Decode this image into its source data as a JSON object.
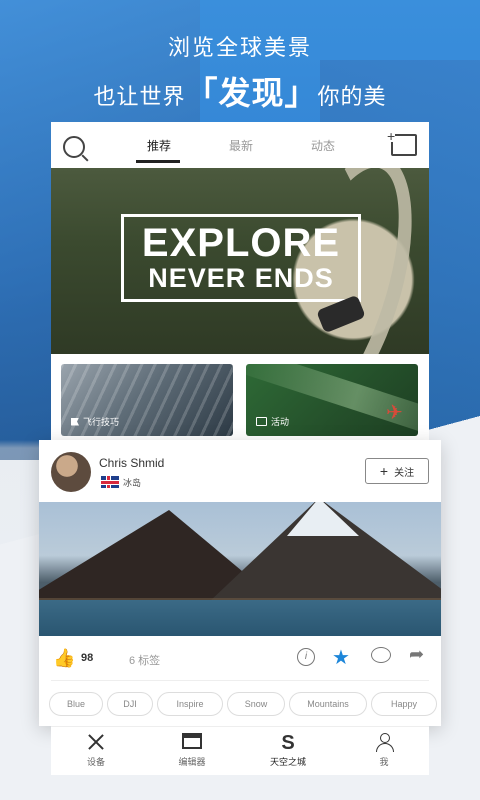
{
  "hero": {
    "line1": "浏览全球美景",
    "line2_prefix": "也让世界",
    "line2_open": "「",
    "line2_highlight": "发现",
    "line2_close": "」",
    "line2_suffix": "你的美"
  },
  "topbar": {
    "tabs": [
      {
        "label": "推荐",
        "active": true
      },
      {
        "label": "最新",
        "active": false
      },
      {
        "label": "动态",
        "active": false
      }
    ],
    "search_icon": "search-icon",
    "add_photo_icon": "add-photo-icon"
  },
  "banner": {
    "line1": "EXPLORE",
    "line2": "NEVER ENDS",
    "page_index": 1
  },
  "tiles": [
    {
      "label": "飞行技巧",
      "icon": "flag-icon"
    },
    {
      "label": "活动",
      "icon": "tag-icon"
    }
  ],
  "post": {
    "username": "Chris Shmid",
    "location": "冰岛",
    "follow_plus": "+",
    "follow_label": "关注",
    "like_count": "98",
    "tags_count": "6 标签",
    "tags": [
      "Blue",
      "DJI",
      "Inspire",
      "Snow",
      "Mountains",
      "Happy"
    ]
  },
  "bottom_nav": [
    {
      "label": "设备",
      "icon": "drone-icon",
      "active": false
    },
    {
      "label": "编辑器",
      "icon": "clapperboard-icon",
      "active": false
    },
    {
      "label": "天空之城",
      "icon": "skypixel-logo-icon",
      "active": true
    },
    {
      "label": "我",
      "icon": "profile-icon",
      "active": false
    }
  ],
  "colors": {
    "accent": "#1d86d9",
    "sky_blue": "#3a8fdc"
  }
}
